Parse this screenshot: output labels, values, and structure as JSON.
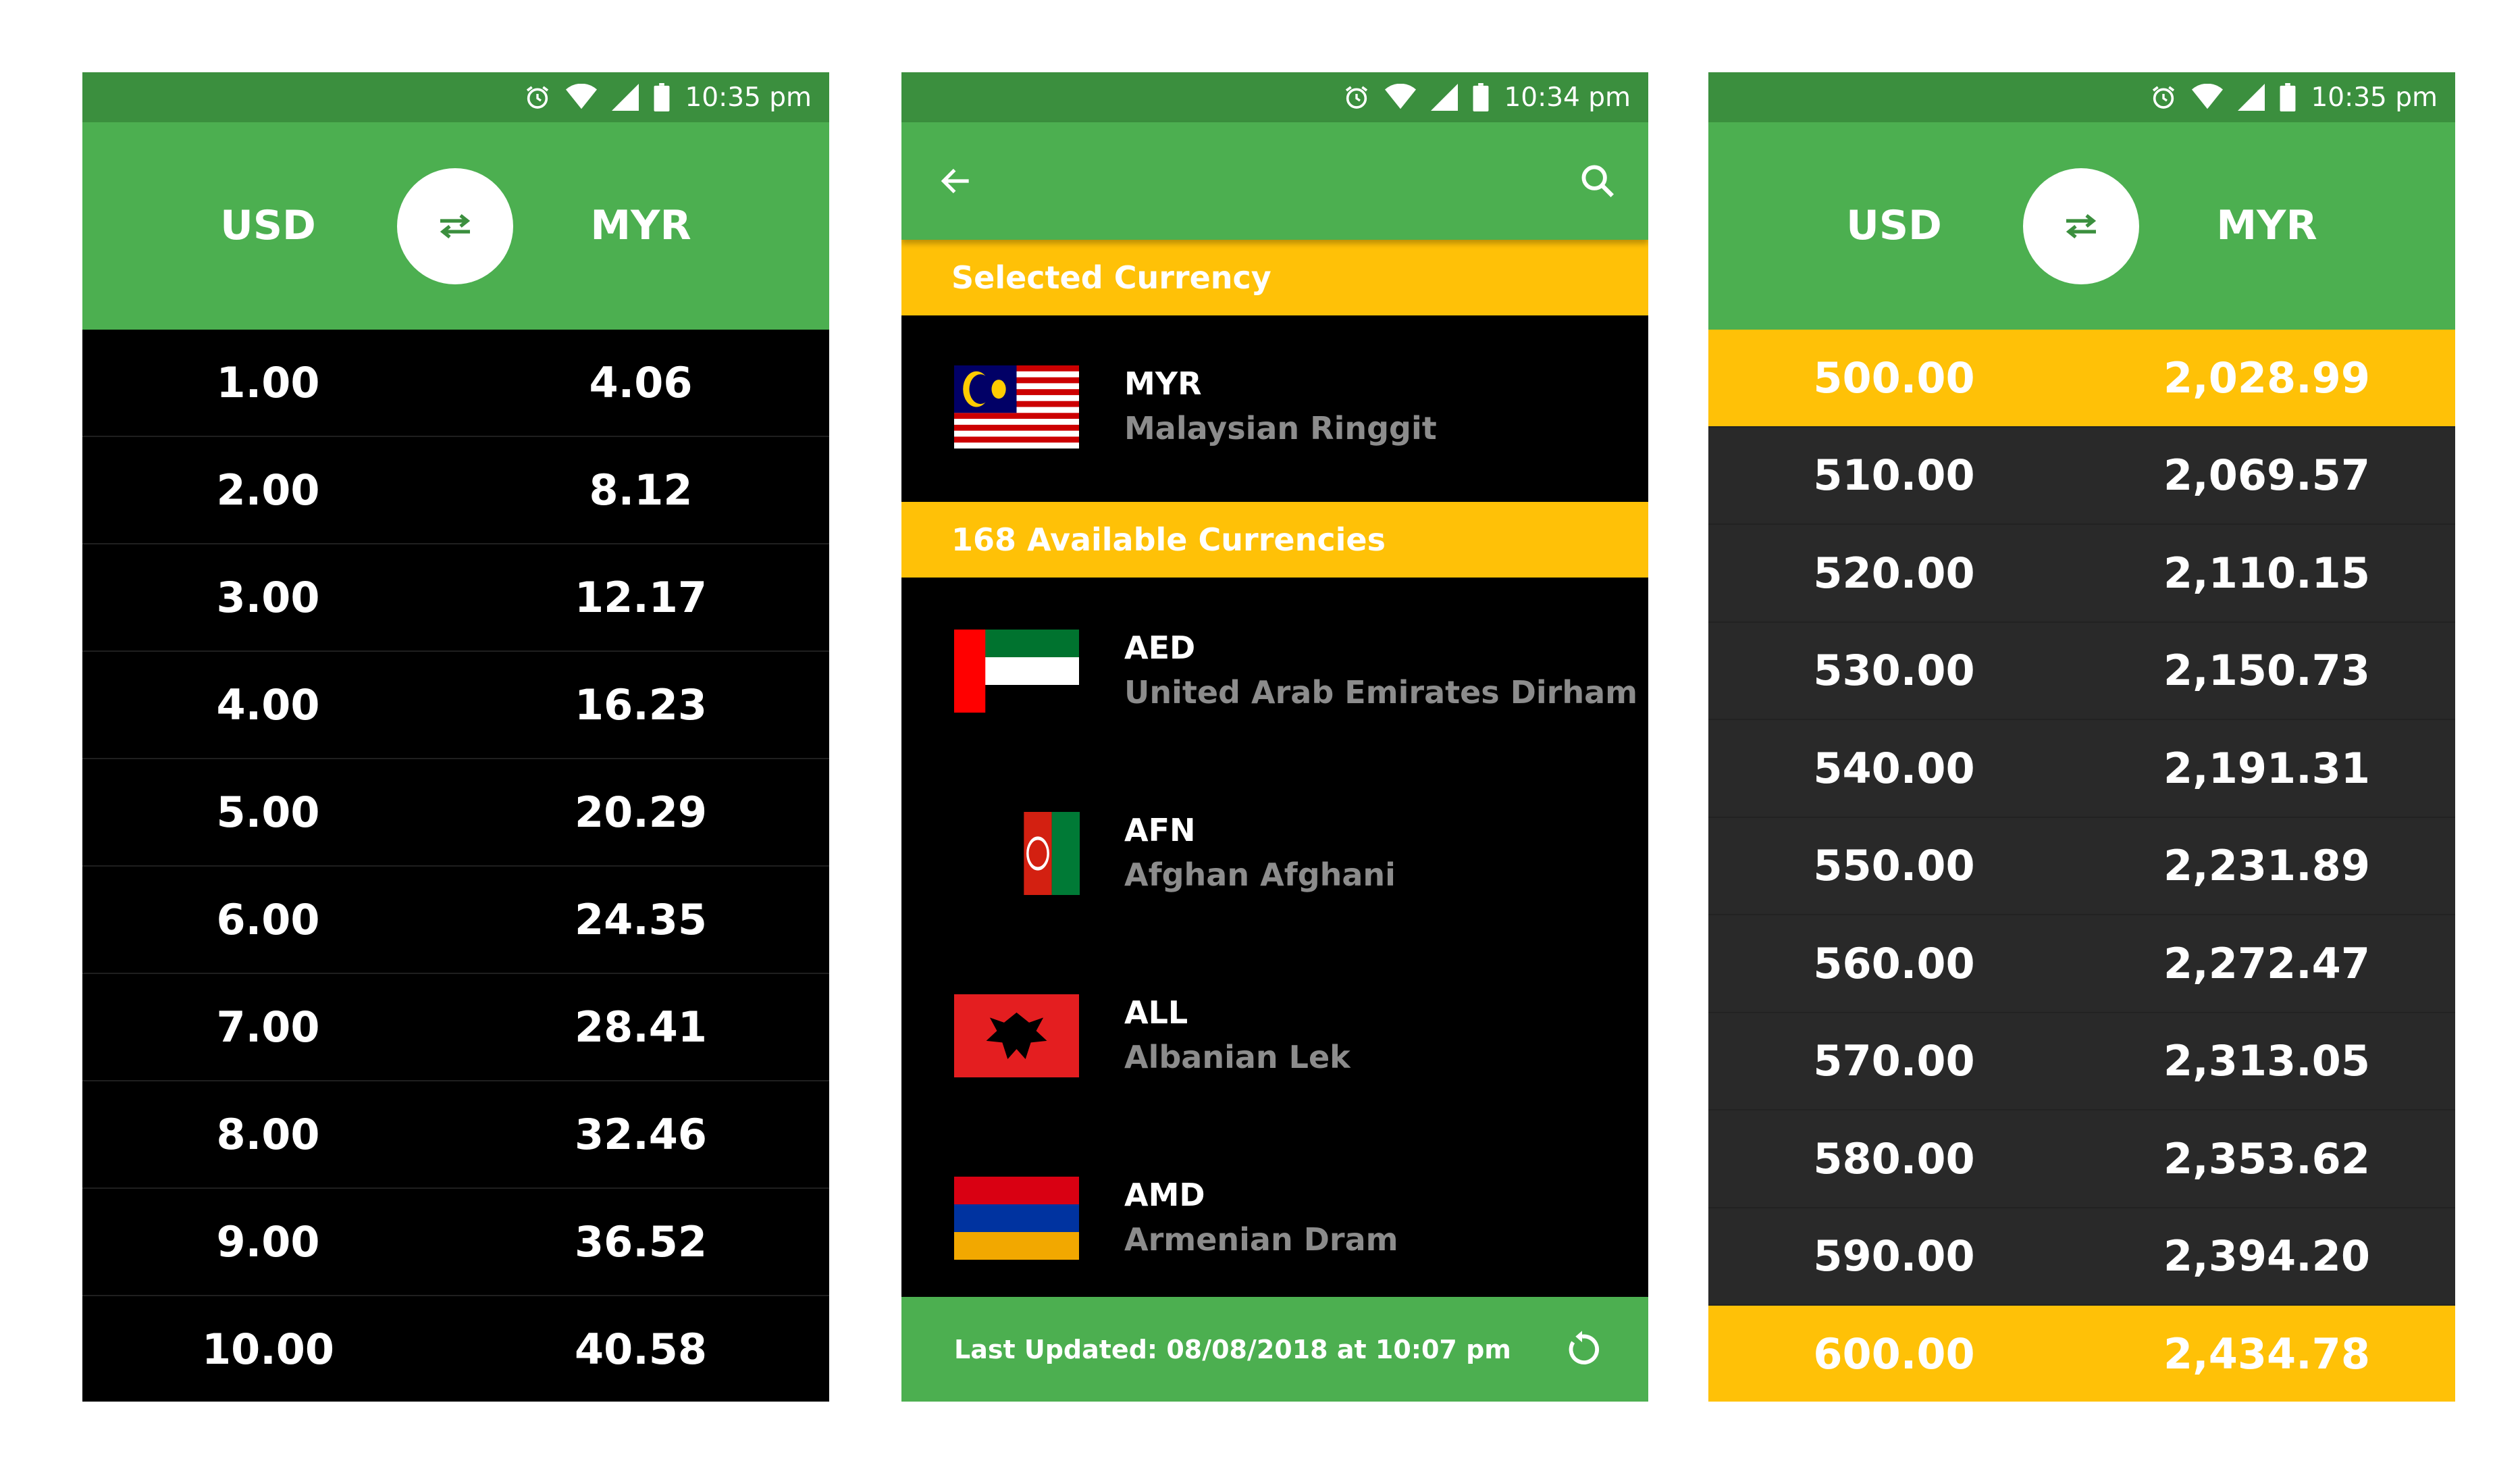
{
  "colors": {
    "green": "#4caf50",
    "dark_green": "#3b8f3e",
    "amber": "#ffc107",
    "black": "#000000",
    "gray_row": "#292929"
  },
  "screen1": {
    "status": {
      "time": "10:35 pm",
      "icons": [
        "alarm-icon",
        "wifi-icon",
        "signal-icon",
        "battery-icon"
      ]
    },
    "header": {
      "from": "USD",
      "to": "MYR",
      "swap_icon": "swap-arrows-icon"
    },
    "rows": [
      {
        "from": "1.00",
        "to": "4.06"
      },
      {
        "from": "2.00",
        "to": "8.12"
      },
      {
        "from": "3.00",
        "to": "12.17"
      },
      {
        "from": "4.00",
        "to": "16.23"
      },
      {
        "from": "5.00",
        "to": "20.29"
      },
      {
        "from": "6.00",
        "to": "24.35"
      },
      {
        "from": "7.00",
        "to": "28.41"
      },
      {
        "from": "8.00",
        "to": "32.46"
      },
      {
        "from": "9.00",
        "to": "36.52"
      },
      {
        "from": "10.00",
        "to": "40.58"
      }
    ]
  },
  "screen2": {
    "status": {
      "time": "10:34 pm",
      "icons": [
        "alarm-icon",
        "wifi-icon",
        "signal-icon",
        "battery-icon"
      ]
    },
    "toolbar": {
      "back_icon": "arrow-back-icon",
      "search_icon": "search-icon"
    },
    "selected_header": "Selected Currency",
    "selected": {
      "code": "MYR",
      "name": "Malaysian Ringgit",
      "flag": "malaysia-flag"
    },
    "available_header": "168 Available Currencies",
    "currencies": [
      {
        "code": "AED",
        "name": "United Arab Emirates Dirham",
        "flag": "uae-flag"
      },
      {
        "code": "AFN",
        "name": "Afghan Afghani",
        "flag": "afghanistan-flag"
      },
      {
        "code": "ALL",
        "name": "Albanian Lek",
        "flag": "albania-flag"
      },
      {
        "code": "AMD",
        "name": "Armenian Dram",
        "flag": "armenia-flag"
      }
    ],
    "footer": {
      "text": "Last Updated: 08/08/2018 at 10:07 pm",
      "refresh_icon": "refresh-icon"
    }
  },
  "screen3": {
    "status": {
      "time": "10:35 pm",
      "icons": [
        "alarm-icon",
        "wifi-icon",
        "signal-icon",
        "battery-icon"
      ]
    },
    "header": {
      "from": "USD",
      "to": "MYR",
      "swap_icon": "swap-arrows-icon"
    },
    "rows": [
      {
        "from": "500.00",
        "to": "2,028.99",
        "highlight": true
      },
      {
        "from": "510.00",
        "to": "2,069.57"
      },
      {
        "from": "520.00",
        "to": "2,110.15"
      },
      {
        "from": "530.00",
        "to": "2,150.73"
      },
      {
        "from": "540.00",
        "to": "2,191.31"
      },
      {
        "from": "550.00",
        "to": "2,231.89"
      },
      {
        "from": "560.00",
        "to": "2,272.47"
      },
      {
        "from": "570.00",
        "to": "2,313.05"
      },
      {
        "from": "580.00",
        "to": "2,353.62"
      },
      {
        "from": "590.00",
        "to": "2,394.20"
      },
      {
        "from": "600.00",
        "to": "2,434.78",
        "highlight": true
      }
    ]
  }
}
